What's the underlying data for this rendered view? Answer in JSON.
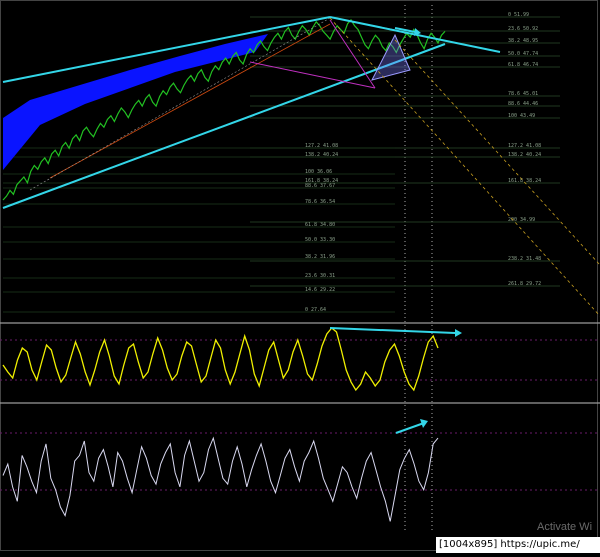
{
  "watermark": "Activate Wi",
  "footer_text": "[1004x895] https://upic.me/",
  "colors": {
    "price": "#22c022",
    "channel_fill": "#0a14ff",
    "trend_line": "#33d6e8",
    "fib_line": "#2a4a2a",
    "osc1": "#f0f000",
    "osc2": "#d8d8f0",
    "divergence": "#33d6e8",
    "magenta_line": "#c030c0",
    "dotted_line": "#c8a020"
  },
  "chart_data": [
    {
      "type": "line",
      "panel": "price",
      "series": [
        {
          "y": [
            40,
            42,
            45,
            43,
            48,
            50,
            52,
            49,
            55,
            58,
            56,
            60,
            62,
            59,
            64,
            66,
            63,
            68,
            70,
            67,
            72,
            74,
            71,
            76,
            78,
            75,
            73,
            77,
            80,
            78,
            82,
            84,
            81,
            85,
            88,
            86,
            83,
            87,
            90,
            92,
            89,
            93,
            95,
            91,
            89,
            94,
            97,
            95,
            99,
            101,
            98,
            96,
            100,
            103,
            105,
            102,
            106,
            108,
            104,
            102,
            107,
            110,
            108,
            112,
            114,
            111,
            115,
            117,
            113,
            111,
            116,
            119,
            117,
            121,
            123,
            120,
            118,
            122,
            125,
            127,
            124,
            128,
            130,
            126,
            124,
            128,
            131,
            129,
            126,
            130,
            133,
            131,
            128,
            126,
            124,
            128,
            131,
            129,
            127,
            132,
            134,
            131,
            129,
            125,
            121,
            119,
            123,
            126,
            124,
            120,
            118,
            122,
            120,
            117,
            121,
            124,
            127,
            125,
            129,
            126,
            122,
            119,
            124,
            127,
            125,
            122,
            126,
            128
          ]
        }
      ],
      "fib_levels": [
        {
          "label": "0 51.99"
        },
        {
          "label": "23.6 50.92"
        },
        {
          "label": "38.2 48.95"
        },
        {
          "label": "50.0 47.74"
        },
        {
          "label": "61.8 46.74"
        },
        {
          "label": "78.6 45.01"
        },
        {
          "label": "88.6 44.46"
        },
        {
          "label": "100 43.49"
        },
        {
          "label": "127.2 41.08"
        },
        {
          "label": "138.2 40.24"
        },
        {
          "label": "161.8 38.24"
        },
        {
          "label": "200 34.99"
        },
        {
          "label": "238.2 31.48"
        },
        {
          "label": "261.8 29.72"
        },
        {
          "label": "127.2 41.08"
        },
        {
          "label": "138.2 40.24"
        },
        {
          "label": "161.8 38.24"
        },
        {
          "label": "100 36.06"
        },
        {
          "label": "88.6 37.67"
        },
        {
          "label": "78.6 36.54"
        },
        {
          "label": "61.8 34.80"
        },
        {
          "label": "50.0 33.30"
        },
        {
          "label": "38.2 31.96"
        },
        {
          "label": "23.6 30.31"
        },
        {
          "label": "14.6 29.22"
        },
        {
          "label": "0 27.64"
        }
      ]
    },
    {
      "type": "line",
      "panel": "oscillator-1",
      "series": [
        {
          "y": [
            55,
            48,
            42,
            60,
            72,
            68,
            50,
            40,
            58,
            75,
            70,
            52,
            38,
            45,
            62,
            78,
            66,
            48,
            35,
            50,
            68,
            80,
            64,
            44,
            36,
            55,
            72,
            76,
            58,
            42,
            48,
            66,
            82,
            70,
            52,
            40,
            46,
            64,
            78,
            74,
            56,
            38,
            44,
            62,
            80,
            72,
            50,
            36,
            48,
            66,
            84,
            70,
            46,
            34,
            52,
            70,
            78,
            60,
            42,
            50,
            68,
            80,
            64,
            46,
            40,
            56,
            74,
            86,
            92,
            88,
            70,
            50,
            38,
            30,
            36,
            48,
            42,
            34,
            40,
            58,
            70,
            76,
            64,
            48,
            36,
            30,
            44,
            62,
            78,
            84,
            72
          ]
        }
      ]
    },
    {
      "type": "line",
      "panel": "oscillator-2",
      "series": [
        {
          "y": [
            48,
            56,
            40,
            30,
            62,
            54,
            44,
            36,
            58,
            70,
            46,
            38,
            26,
            20,
            34,
            58,
            62,
            72,
            50,
            44,
            60,
            66,
            54,
            40,
            64,
            58,
            46,
            36,
            52,
            68,
            60,
            48,
            42,
            56,
            64,
            70,
            50,
            40,
            62,
            72,
            58,
            44,
            50,
            66,
            74,
            60,
            46,
            42,
            58,
            68,
            56,
            40,
            52,
            62,
            70,
            58,
            44,
            36,
            48,
            60,
            66,
            54,
            44,
            58,
            64,
            72,
            60,
            46,
            38,
            30,
            42,
            54,
            50,
            40,
            32,
            46,
            58,
            64,
            52,
            40,
            30,
            16,
            34,
            52,
            60,
            66,
            56,
            44,
            38,
            50,
            70,
            74
          ]
        }
      ]
    }
  ]
}
